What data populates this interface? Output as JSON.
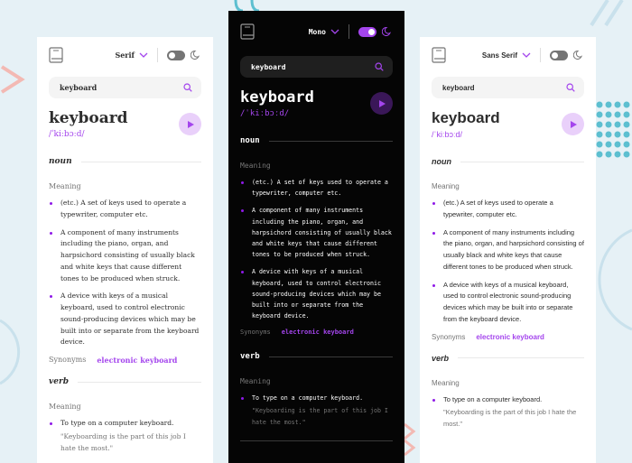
{
  "colors": {
    "accent": "#a445ed",
    "background": "#e6f1f6",
    "card_light": "#ffffff",
    "card_dark": "#050505"
  },
  "cards": [
    {
      "theme": "light",
      "font_label": "Serif",
      "toggle_on": false,
      "search_value": "keyboard",
      "word": "keyboard",
      "phonetic": "/ˈkiːbɔːd/",
      "noun": {
        "label": "noun",
        "meaning_label": "Meaning",
        "defs": [
          "(etc.) A set of keys used to operate a typewriter, computer etc.",
          "A component of many instruments including the piano, organ, and harpsichord consisting of usually black and white keys that cause different tones to be produced when struck.",
          "A device with keys of a musical keyboard, used to control electronic sound-producing devices which may be built into or separate from the keyboard device."
        ],
        "synonyms_label": "Synonyms",
        "synonym": "electronic keyboard"
      },
      "verb": {
        "label": "verb",
        "meaning_label": "Meaning",
        "def": "To type on a computer keyboard.",
        "example": "\"Keyboarding is the part of this job I hate the most.\""
      }
    },
    {
      "theme": "dark",
      "font_label": "Mono",
      "toggle_on": true,
      "search_value": "keyboard",
      "word": "keyboard",
      "phonetic": "/ˈkiːbɔːd/",
      "noun": {
        "label": "noun",
        "meaning_label": "Meaning",
        "defs": [
          "(etc.) A set of keys used to operate a typewriter, computer etc.",
          "A component of many instruments including the piano, organ, and harpsichord consisting of usually black and white keys that cause different tones to be produced when struck.",
          "A device with keys of a musical keyboard, used to control electronic sound-producing devices which may be built into or separate from the keyboard device."
        ],
        "synonyms_label": "Synonyms",
        "synonym": "electronic keyboard"
      },
      "verb": {
        "label": "verb",
        "meaning_label": "Meaning",
        "def": "To type on a computer keyboard.",
        "example": "\"Keyboarding is the part of this job I hate the most.\""
      }
    },
    {
      "theme": "light",
      "font_label": "Sans Serif",
      "toggle_on": false,
      "search_value": "keyboard",
      "word": "keyboard",
      "phonetic": "/ˈkiːbɔːd/",
      "noun": {
        "label": "noun",
        "meaning_label": "Meaning",
        "defs": [
          "(etc.) A set of keys used to operate a typewriter, computer etc.",
          "A component of many instruments including the piano, organ, and harpsichord consisting of usually black and white keys that cause different tones to be produced when struck.",
          "A device with keys of a musical keyboard, used to control electronic sound-producing devices which may be built into or separate from the keyboard device."
        ],
        "synonyms_label": "Synonyms",
        "synonym": "electronic keyboard"
      },
      "verb": {
        "label": "verb",
        "meaning_label": "Meaning",
        "def": "To type on a computer keyboard.",
        "example": "\"Keyboarding is the part of this job I hate the most.\""
      }
    }
  ]
}
